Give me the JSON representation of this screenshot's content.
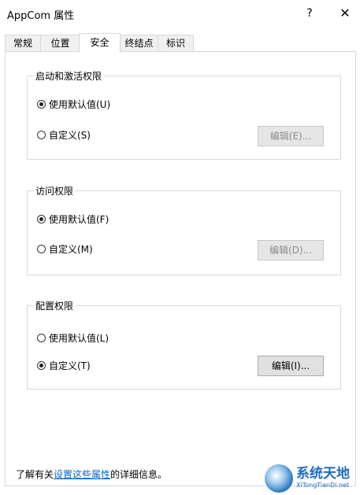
{
  "window": {
    "title": "AppCom 属性",
    "help_label": "?",
    "close_label": "✕"
  },
  "tabs": [
    {
      "label": "常规",
      "active": false
    },
    {
      "label": "位置",
      "active": false
    },
    {
      "label": "安全",
      "active": true
    },
    {
      "label": "终结点",
      "active": false
    },
    {
      "label": "标识",
      "active": false
    }
  ],
  "groups": [
    {
      "legend": "启动和激活权限",
      "default_option": "使用默认值(U)",
      "custom_option": "自定义(S)",
      "selected": "default",
      "edit_label": "编辑(E)...",
      "edit_enabled": false
    },
    {
      "legend": "访问权限",
      "default_option": "使用默认值(F)",
      "custom_option": "自定义(M)",
      "selected": "default",
      "edit_label": "编辑(D)...",
      "edit_enabled": false
    },
    {
      "legend": "配置权限",
      "default_option": "使用默认值(L)",
      "custom_option": "自定义(T)",
      "selected": "custom",
      "edit_label": "编辑(I)...",
      "edit_enabled": true
    }
  ],
  "info": {
    "prefix": "了解有关",
    "link": "设置这些属性",
    "suffix": "的详细信息。"
  },
  "watermark": {
    "main": "系统天地",
    "sub": "XiTongTianDi.net"
  }
}
